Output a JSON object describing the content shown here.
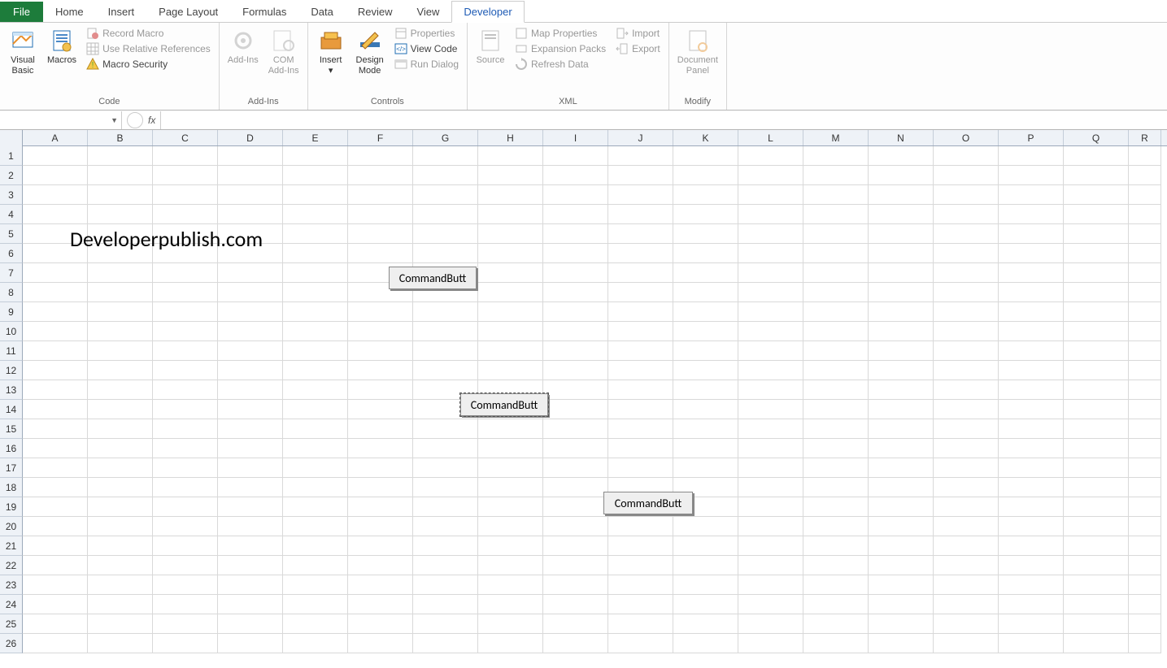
{
  "tabs": {
    "file": "File",
    "items": [
      "Home",
      "Insert",
      "Page Layout",
      "Formulas",
      "Data",
      "Review",
      "View",
      "Developer"
    ],
    "active": "Developer"
  },
  "ribbon": {
    "code": {
      "label": "Code",
      "visual_basic": "Visual\nBasic",
      "macros": "Macros",
      "record_macro": "Record Macro",
      "use_relative": "Use Relative References",
      "macro_security": "Macro Security"
    },
    "addins": {
      "label": "Add-Ins",
      "addins": "Add-Ins",
      "com_addins": "COM\nAdd-Ins"
    },
    "controls": {
      "label": "Controls",
      "insert": "Insert",
      "design_mode": "Design\nMode",
      "properties": "Properties",
      "view_code": "View Code",
      "run_dialog": "Run Dialog"
    },
    "xml": {
      "label": "XML",
      "source": "Source",
      "map_properties": "Map Properties",
      "expansion_packs": "Expansion Packs",
      "refresh_data": "Refresh Data",
      "import": "Import",
      "export": "Export"
    },
    "modify": {
      "label": "Modify",
      "document_panel": "Document\nPanel"
    }
  },
  "formula_bar": {
    "name_box": "",
    "fx_label": "fx",
    "formula": ""
  },
  "columns": [
    "A",
    "B",
    "C",
    "D",
    "E",
    "F",
    "G",
    "H",
    "I",
    "J",
    "K",
    "L",
    "M",
    "N",
    "O",
    "P",
    "Q",
    "R"
  ],
  "rows": [
    "1",
    "2",
    "3",
    "4",
    "5",
    "6",
    "7",
    "8",
    "9",
    "10",
    "11",
    "12",
    "13",
    "14",
    "15",
    "16",
    "17",
    "18",
    "19",
    "20",
    "21",
    "22",
    "23",
    "24",
    "25",
    "26"
  ],
  "sheet_text": "Developerpublish.com",
  "buttons": {
    "b1": "CommandButt",
    "b2": "CommandButt",
    "b3": "CommandButt"
  }
}
